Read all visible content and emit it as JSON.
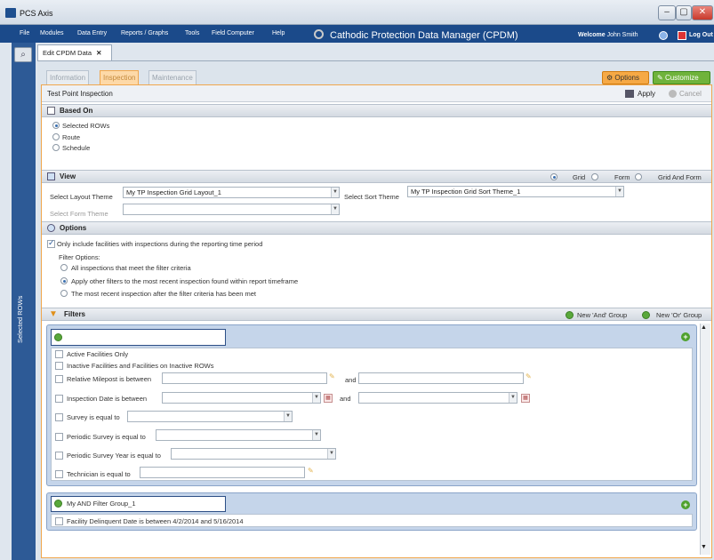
{
  "window": {
    "title": "PCS Axis",
    "min": "–",
    "max": "▢",
    "close": "✕"
  },
  "menu": [
    "File",
    "Modules",
    "Data Entry",
    "Reports / Graphs",
    "Tools",
    "Field Computer",
    "Help"
  ],
  "app_title": "Cathodic Protection Data Manager (CPDM)",
  "welcome_label": "Welcome",
  "user": "John Smith",
  "logout": "Log Out",
  "side_label": "Selected ROWs",
  "doc_tab": {
    "label": "Edit CPDM Data",
    "close": "✕"
  },
  "subtabs": [
    "Information",
    "Inspection",
    "Maintenance"
  ],
  "options_btn": "Options",
  "customize_btn": "Customize",
  "panel_title": "Test Point Inspection",
  "apply": "Apply",
  "cancel": "Cancel",
  "based_on": {
    "title": "Based On",
    "options": [
      "Selected ROWs",
      "Route",
      "Schedule"
    ]
  },
  "view": {
    "title": "View",
    "modes": [
      "Grid",
      "Form",
      "Grid And Form"
    ],
    "layout_label": "Select Layout Theme",
    "layout_value": "My TP Inspection Grid Layout_1",
    "sort_label": "Select Sort Theme",
    "sort_value": "My TP Inspection Grid Sort Theme_1",
    "form_label": "Select Form Theme"
  },
  "options": {
    "title": "Options",
    "include": "Only include facilities with inspections during the reporting time period",
    "filter_label": "Filter Options:",
    "choices": [
      "All inspections that meet the filter criteria",
      "Apply other filters to the most recent inspection found within report timeframe",
      "The most recent inspection after the filter criteria has been met"
    ]
  },
  "filters": {
    "title": "Filters",
    "new_and": "New 'And' Group",
    "new_or": "New 'Or' Group",
    "rows": [
      "Active Facilities Only",
      "Inactive Facilities and Facilities on Inactive ROWs",
      "Relative Milepost is between",
      "Inspection Date is between",
      "Survey is equal to",
      "Periodic Survey is equal to",
      "Periodic Survey Year is equal to",
      "Technician is equal to"
    ],
    "and": "and",
    "group2_name": "My AND Filter Group_1",
    "group2_row": "Facility Delinquent Date is between",
    "date1": "4/2/2014",
    "and2": "and",
    "date2": "5/16/2014"
  }
}
